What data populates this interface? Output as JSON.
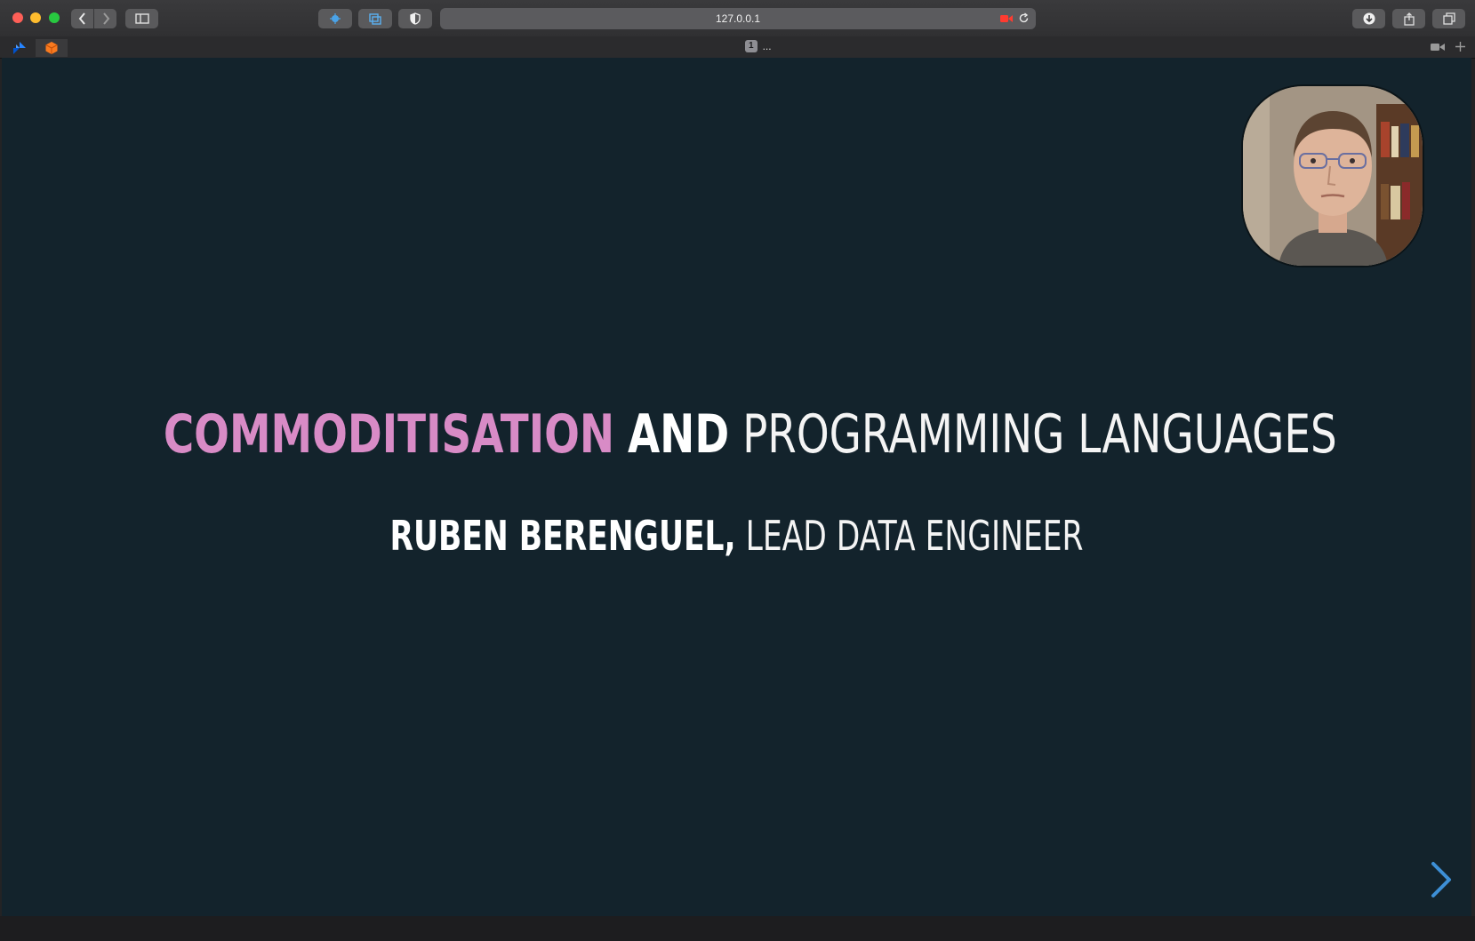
{
  "browser": {
    "url": "127.0.0.1",
    "tab": {
      "index_badge": "1",
      "title": "..."
    }
  },
  "slide": {
    "title": {
      "part1": "COMMODITISATION",
      "part2": "AND",
      "part3": "PROGRAMMING LANGUAGES"
    },
    "subtitle": {
      "name": "RUBEN BERENGUEL,",
      "role": "LEAD DATA ENGINEER"
    }
  },
  "colors": {
    "slide_bg": "#13232c",
    "accent_pink": "#d88bc6",
    "nav_arrow": "#3d8fd6"
  },
  "icons": [
    "back-icon",
    "forward-icon",
    "sidebar-icon",
    "extension-icon",
    "extension2-icon",
    "shield-icon",
    "record-icon",
    "reload-icon",
    "download-icon",
    "share-icon",
    "tabs-overview-icon",
    "camera-icon",
    "new-tab-icon",
    "chevron-right-icon"
  ]
}
